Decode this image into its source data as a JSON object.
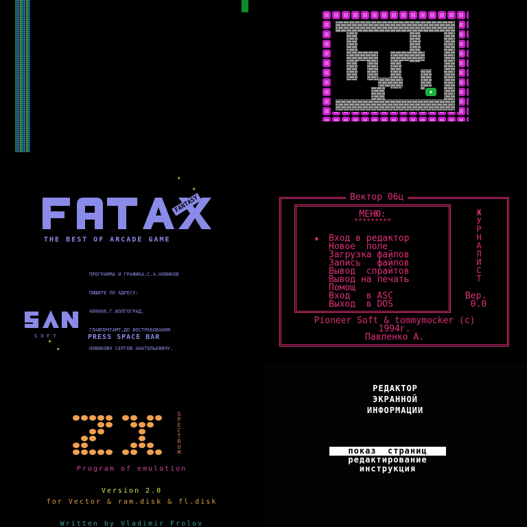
{
  "panels": {
    "noise": {},
    "maze": {
      "colors": {
        "frame": "#c020c0",
        "brick": "#9a9a9a",
        "mortar": "#3a3a3a",
        "player": "#20b040"
      }
    },
    "fatax": {
      "logo": "FATAX",
      "logo_badge": "FANTASY",
      "tagline": "THE BEST OF ARCADE GAME",
      "credits": [
        "ПРОГРАММА И ГРАФИКА:С.А.НОВИКОВ",
        "ПИШИТЕ ПО АДРЕСУ:",
        "400066,Г.ВОЛГОГРАД,",
        "ГЛАВПОЧТАМТ,ДО ВОСТРЕБОВАНИЯ",
        "НОВИКОВУ СЕРГЕЮ АНАТОЛЬЕВИЧУ."
      ],
      "publisher": "SAN",
      "publisher_sub": "SOFT",
      "prompt": "PRESS SPACE BAR",
      "color": "#8a8ae8"
    },
    "vector_menu": {
      "title": "Вектор  06ц",
      "menu_label": "МЕНЮ:",
      "menu_underline": "*********",
      "cursor": "♦",
      "items": [
        "Вход в редактор",
        "Новое  поле",
        "Загрузка файлов",
        "Запись   файлов",
        "Вывод  спрайтов",
        "Вывод на печать",
        "Помощ",
        "Вход   в ASC",
        "Выход  в DOS"
      ],
      "side_label": "ЖУРНАЛИСТ",
      "version_label": "Вер.",
      "version_value": "0.0",
      "footer": [
        "Pioneer Soft & tommymocker (c)",
        "1994г.",
        "Павленко А."
      ],
      "color": "#e0307a"
    },
    "zx": {
      "logo": "ZX",
      "logo_side": "SPECTRUM",
      "subtitle": "Program of emulation",
      "version": "Version 2.0",
      "target": "for Vector & ram.disk & fl.disk",
      "author": "Written by Vladimir Frolov",
      "colors": {
        "logo": "#f0a050",
        "subtitle": "#d040a0",
        "version": "#e0e060",
        "target": "#e0a040",
        "author": "#40a0a0"
      }
    },
    "editor": {
      "title": [
        "РЕДАКТОР",
        "ЭКРАННОЙ",
        "ИНФОРМАЦИИ"
      ],
      "menu": [
        {
          "label": "показ  страниц",
          "selected": true
        },
        {
          "label": "редактирование",
          "selected": false
        },
        {
          "label": "инструкция",
          "selected": false
        }
      ]
    }
  }
}
